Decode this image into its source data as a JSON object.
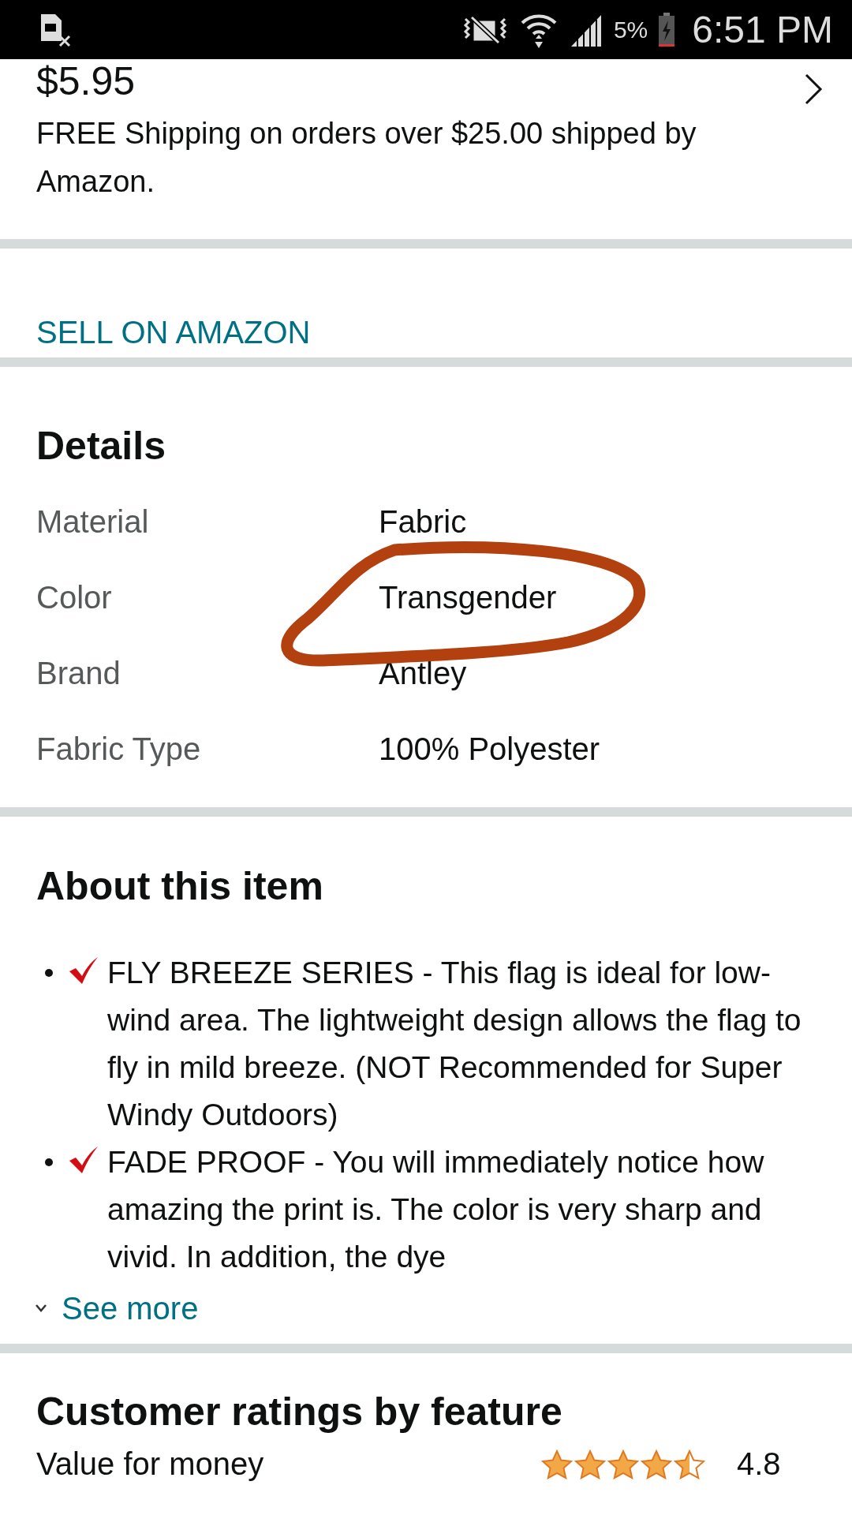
{
  "status_bar": {
    "battery": "5%",
    "time": "6:51 PM"
  },
  "shipping": {
    "price": "$5.95",
    "note": "FREE Shipping on orders over $25.00 shipped by Amazon."
  },
  "sell_link": "SELL ON AMAZON",
  "details": {
    "title": "Details",
    "rows": [
      {
        "label": "Material",
        "value": "Fabric"
      },
      {
        "label": "Color",
        "value": "Transgender"
      },
      {
        "label": "Brand",
        "value": "Antley"
      },
      {
        "label": "Fabric Type",
        "value": "100% Polyester"
      }
    ]
  },
  "about": {
    "title": "About this item",
    "bullets": [
      {
        "text": "FLY BREEZE SERIES - This flag is ideal for low-wind area. The lightweight design allows the flag to fly in mild breeze. (NOT Recommended for Super Windy Outdoors)"
      },
      {
        "text": "FADE PROOF - You will immediately notice how amazing the print is. The color is very sharp and vivid. In addition, the dye"
      }
    ],
    "see_more": "See more"
  },
  "ratings": {
    "title": "Customer ratings by feature",
    "features": [
      {
        "name": "Value for money",
        "stars": 4.5,
        "score": "4.8"
      }
    ]
  }
}
